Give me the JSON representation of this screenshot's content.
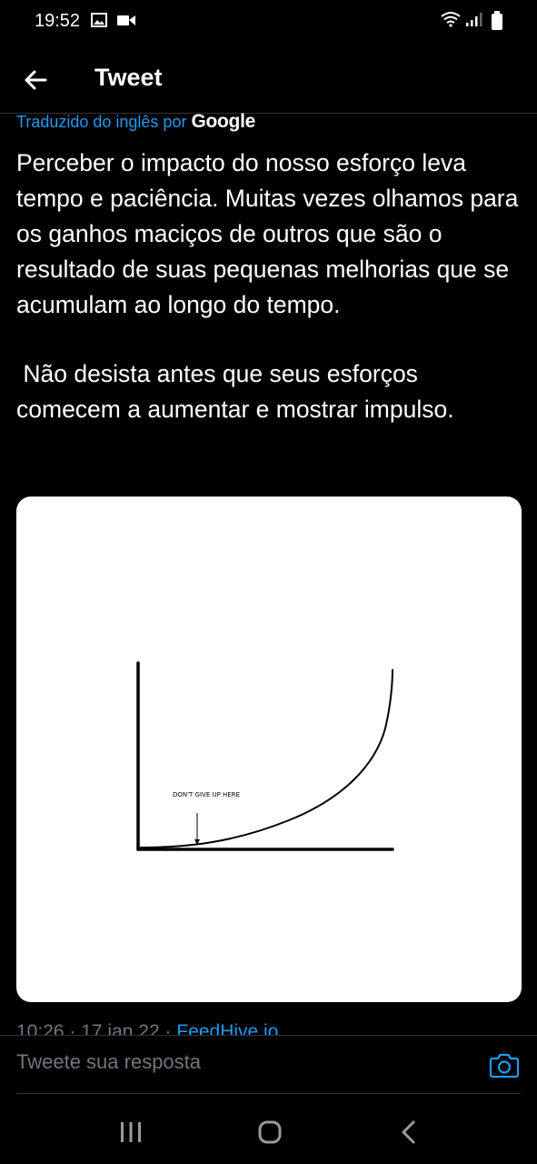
{
  "status_bar": {
    "time": "19:52",
    "icons": [
      "image-icon",
      "video-icon",
      "wifi-icon",
      "signal-icon",
      "battery-icon"
    ]
  },
  "header": {
    "title": "Tweet",
    "back_icon": "arrow-left-icon"
  },
  "tweet": {
    "translated_label": "Traduzido do inglês por",
    "translation_brand": "Google",
    "paragraphs": [
      "Perceber o impacto do nosso esforço leva tempo e paciência. Muitas vezes olhamos para os ganhos maciços de outros que são o resultado de suas pequenas melhorias que se acumulam ao longo do tempo.",
      " Não desista antes que seus esforços comecem a aumentar e mostrar impulso."
    ],
    "image": {
      "annotation": "DON'T GIVE UP HERE"
    },
    "meta": {
      "time": "10:26",
      "separator": " · ",
      "date": "17 jan 22",
      "source": "FeedHive.io"
    }
  },
  "reply": {
    "placeholder": "Tweete sua resposta",
    "camera_icon": "camera-icon"
  },
  "nav_bar": {
    "icons": [
      "recents-icon",
      "home-icon",
      "back-icon"
    ]
  },
  "colors": {
    "background": "#000000",
    "accent": "#1d9bf0",
    "text": "#ffffff",
    "muted": "#71767b"
  }
}
